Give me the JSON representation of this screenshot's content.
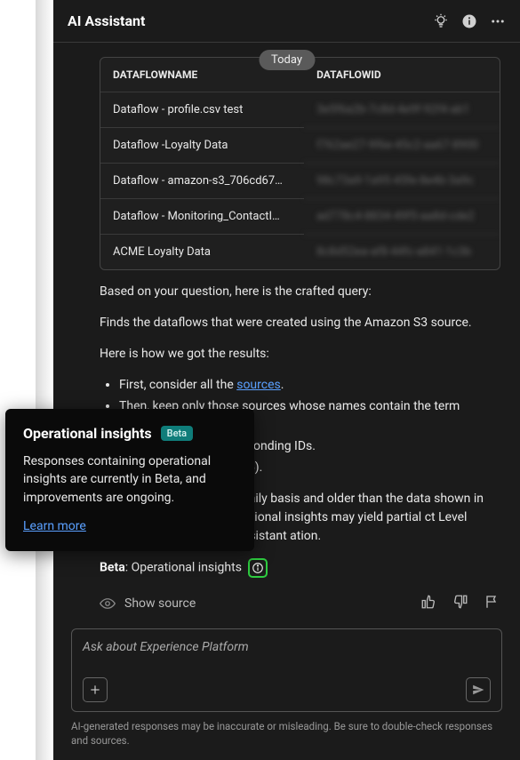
{
  "header": {
    "title": "AI Assistant"
  },
  "today_label": "Today",
  "table": {
    "headers": {
      "name": "DATAFLOWNAME",
      "id": "DATAFLOWID"
    },
    "rows": [
      {
        "name": "Dataflow - profile.csv test",
        "id": "3e5f6a2b-7c8d-4e9f-92f4-ab1"
      },
      {
        "name": "Dataflow -Loyalty Data",
        "id": "f762ae27-9f6e-45c2-aa67-8900"
      },
      {
        "name": "Dataflow - amazon-s3_706cd67…",
        "id": "98c73a9-1a95-45fe-8e4b-3a9c"
      },
      {
        "name": "Dataflow - Monitoring_ContactI…",
        "id": "ad778c4-8834-49f5-aa8d-cde2"
      },
      {
        "name": "ACME Loyalty Data",
        "id": "8c8d52ea-af8-44fc-a841-1c3b"
      }
    ]
  },
  "response": {
    "intro": "Based on your question, here is the crafted query:",
    "summary": "Finds the dataflows that were created using the Amazon S3 source.",
    "how_intro": "Here is how we got the results:",
    "steps": {
      "s1a": "First, consider all the ",
      "s1_link": "sources",
      "s1b": ".",
      "s2": "Then, keep only those sources whose names contain the term 'Amazon S3'.",
      "s3_pre": "names and their corresponding IDs.",
      "s4_pre": "if there are more than 25)."
    },
    "note_text": "ponses is computed on a daily basis and older than the data shown in the Experience Some operational insights may yield partial ct Level Access Controls. See AI Assistant ation.",
    "beta_prefix": "Beta",
    "beta_text": ": Operational insights",
    "show_source": "Show source"
  },
  "popover": {
    "title": "Operational insights",
    "badge": "Beta",
    "body": "Responses containing operational insights are currently in Beta, and improvements are ongoing.",
    "link": "Learn more"
  },
  "input": {
    "placeholder": "Ask about Experience Platform"
  },
  "disclaimer": "AI-generated responses may be inaccurate or misleading. Be sure to double-check responses and sources."
}
